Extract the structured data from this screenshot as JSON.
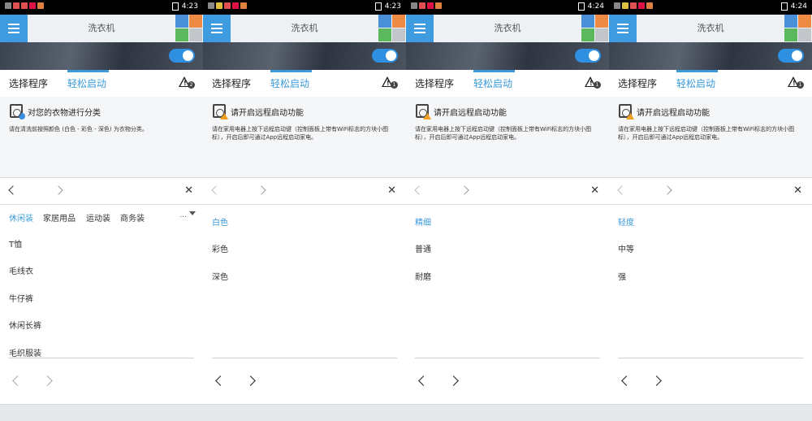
{
  "panels": [
    {
      "status_time": "4:23",
      "app_title": "洗衣机",
      "tabs": [
        "选择程序",
        "轻松启动"
      ],
      "warning_count": "2",
      "info_title": "对您的衣物进行分类",
      "info_body": "请在清洗前按照颜色 (白色 - 彩色 - 深色) 为衣物分类。",
      "info_icon": "laundry-basket-info-icon",
      "categories": [
        "休闲装",
        "家居用品",
        "运动装",
        "商务装"
      ],
      "categories_more": "...",
      "options": [
        "T恤",
        "毛线衣",
        "牛仔裤",
        "休闲长裤",
        "毛织服装"
      ],
      "active_option_index": -1
    },
    {
      "status_time": "4:23",
      "app_title": "洗衣机",
      "tabs": [
        "选择程序",
        "轻松启动"
      ],
      "warning_count": "1",
      "info_title": "请开启远程启动功能",
      "info_body": "请在家用电器上按下远程启动键（控制面板上带有WiFi标志的方块小图标），开启后即可通过App远程启动家电。",
      "info_icon": "washer-warning-icon",
      "options": [
        "白色",
        "彩色",
        "深色"
      ],
      "active_option_index": 0
    },
    {
      "status_time": "4:24",
      "app_title": "洗衣机",
      "tabs": [
        "选择程序",
        "轻松启动"
      ],
      "warning_count": "1",
      "info_title": "请开启远程启动功能",
      "info_body": "请在家用电器上按下远程启动键（控制面板上带有WiFi标志的方块小图标），开启后即可通过App远程启动家电。",
      "info_icon": "washer-warning-icon",
      "options": [
        "精细",
        "普通",
        "耐磨"
      ],
      "active_option_index": 0
    },
    {
      "status_time": "4:24",
      "app_title": "洗衣机",
      "tabs": [
        "选择程序",
        "轻松启动"
      ],
      "warning_count": "1",
      "info_title": "请开启远程启动功能",
      "info_body": "请在家用电器上按下远程启动键（控制面板上带有WiFi标志的方块小图标），开启后即可通过App远程启动家电。",
      "info_icon": "washer-warning-icon",
      "options": [
        "轻度",
        "中等",
        "强"
      ],
      "active_option_index": 0
    }
  ],
  "colors": {
    "accent": "#3a9ad9",
    "menu_button": "#3f9be0",
    "toggle_on": "#2f8fe0",
    "tile_blue": "#4a90d9",
    "tile_orange": "#ef8a45",
    "tile_green": "#5cb85c",
    "tile_gray": "#c2c6cb"
  },
  "icons": {
    "menu": "hamburger-menu-icon",
    "tiles": "app-tiles-icon",
    "toggle": "remote-start-toggle",
    "warning": "warning-triangle-icon",
    "back": "chevron-left-icon",
    "forward": "chevron-right-icon",
    "close": "close-icon",
    "dropdown": "caret-down-icon"
  }
}
